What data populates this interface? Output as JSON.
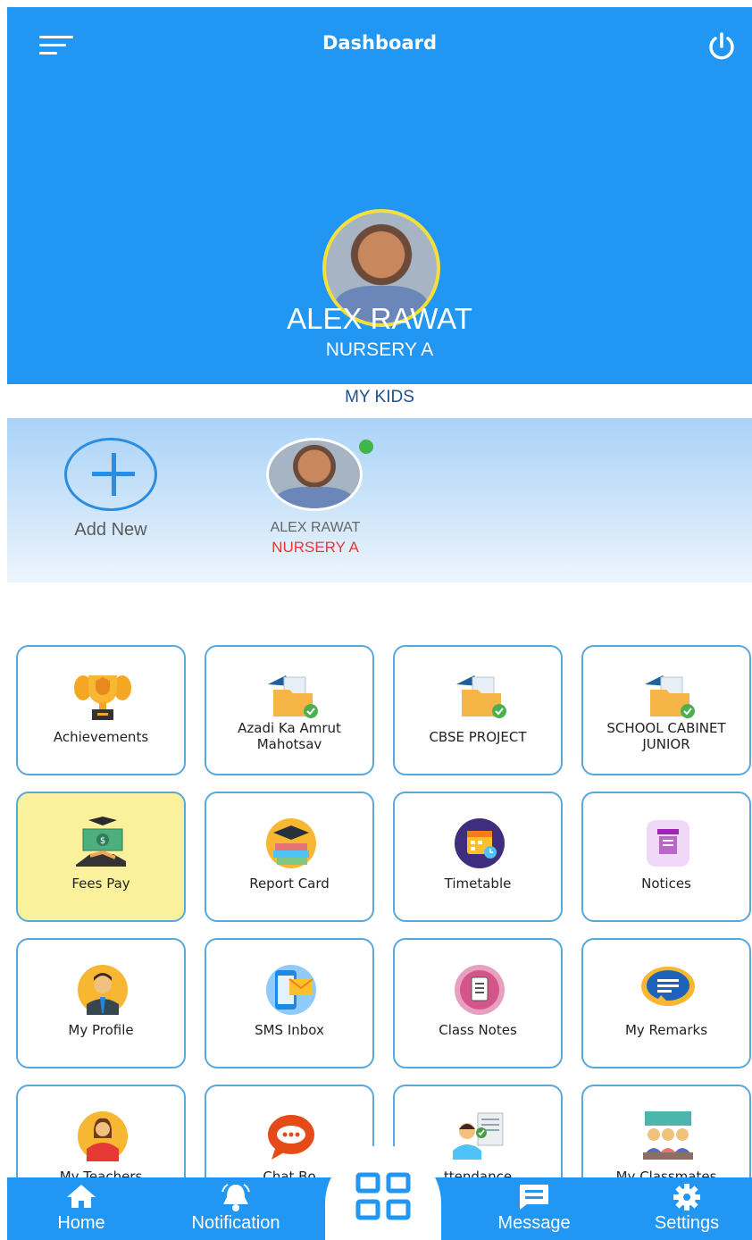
{
  "header": {
    "title": "Dashboard"
  },
  "hero": {
    "name": "ALEX RAWAT",
    "class": "NURSERY A"
  },
  "my_kids": {
    "label": "MY KIDS",
    "add_label": "Add New",
    "kid": {
      "name": "ALEX RAWAT",
      "class": "NURSERY A"
    }
  },
  "tiles": [
    {
      "label": "Achievements",
      "icon": "trophy-icon"
    },
    {
      "label": "Azadi Ka Amrut Mahotsav",
      "icon": "folder-check-icon"
    },
    {
      "label": "CBSE PROJECT",
      "icon": "folder-check-icon"
    },
    {
      "label": "SCHOOL CABINET JUNIOR",
      "icon": "folder-check-icon"
    },
    {
      "label": "Fees Pay",
      "icon": "money-hand-icon"
    },
    {
      "label": "Report Card",
      "icon": "graduation-book-icon"
    },
    {
      "label": "Timetable",
      "icon": "calendar-clock-icon"
    },
    {
      "label": "Notices",
      "icon": "notice-board-icon"
    },
    {
      "label": "My Profile",
      "icon": "student-profile-icon"
    },
    {
      "label": "SMS Inbox",
      "icon": "sms-inbox-icon"
    },
    {
      "label": "Class Notes",
      "icon": "notes-icon"
    },
    {
      "label": "My Remarks",
      "icon": "speech-bubble-icon"
    },
    {
      "label": "My Teachers",
      "icon": "teacher-icon"
    },
    {
      "label": "Chat Bo",
      "icon": "chat-icon"
    },
    {
      "label": "ttendance",
      "icon": "attendance-icon"
    },
    {
      "label": "My Classmates",
      "icon": "classmates-icon"
    }
  ],
  "nav": {
    "home": "Home",
    "notification": "Notification",
    "message": "Message",
    "settings": "Settings"
  },
  "colors": {
    "primary": "#2196f3",
    "accent_yellow": "#f4e03a",
    "class_red": "#e53935",
    "highlight_tile": "#fbf19d"
  }
}
